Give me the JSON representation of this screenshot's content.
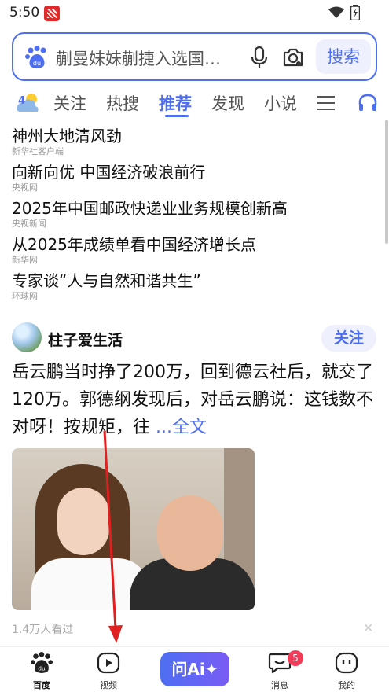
{
  "status_bar": {
    "time": "5:50"
  },
  "search": {
    "query": "蒯曼妹妹蒯捷入选国…",
    "button_label": "搜索"
  },
  "tabs": [
    {
      "label": "关注"
    },
    {
      "label": "热搜"
    },
    {
      "label": "推荐"
    },
    {
      "label": "发现"
    },
    {
      "label": "小说"
    }
  ],
  "active_tab": "推荐",
  "hot_news": [
    {
      "title": "神州大地清风劲",
      "source": "新华社客户端"
    },
    {
      "title": "向新向优 中国经济破浪前行",
      "source": "央视网"
    },
    {
      "title": "2025年中国邮政快递业业务规模创新高",
      "source": "央视新闻"
    },
    {
      "title": "从2025年成绩单看中国经济增长点",
      "source": "新华网"
    },
    {
      "title": "专家谈“人与自然和谐共生”",
      "source": "环球网"
    }
  ],
  "feed": {
    "author": "柱子爱生活",
    "follow_label": "关注",
    "text": "岳云鹏当时挣了200万，回到德云社后，就交了120万。郭德纲发现后，对岳云鹏说：这钱数不对呀！按规矩，往",
    "more_label": "...全文",
    "views": "1.4万人看过"
  },
  "bottom_nav": {
    "home": "百度",
    "video": "视频",
    "ai": "问Ai",
    "messages": "消息",
    "messages_badge": "5",
    "me": "我的"
  },
  "colors": {
    "accent": "#4e6ef2",
    "badge": "#f33a58",
    "annotation_arrow": "#e02020"
  }
}
